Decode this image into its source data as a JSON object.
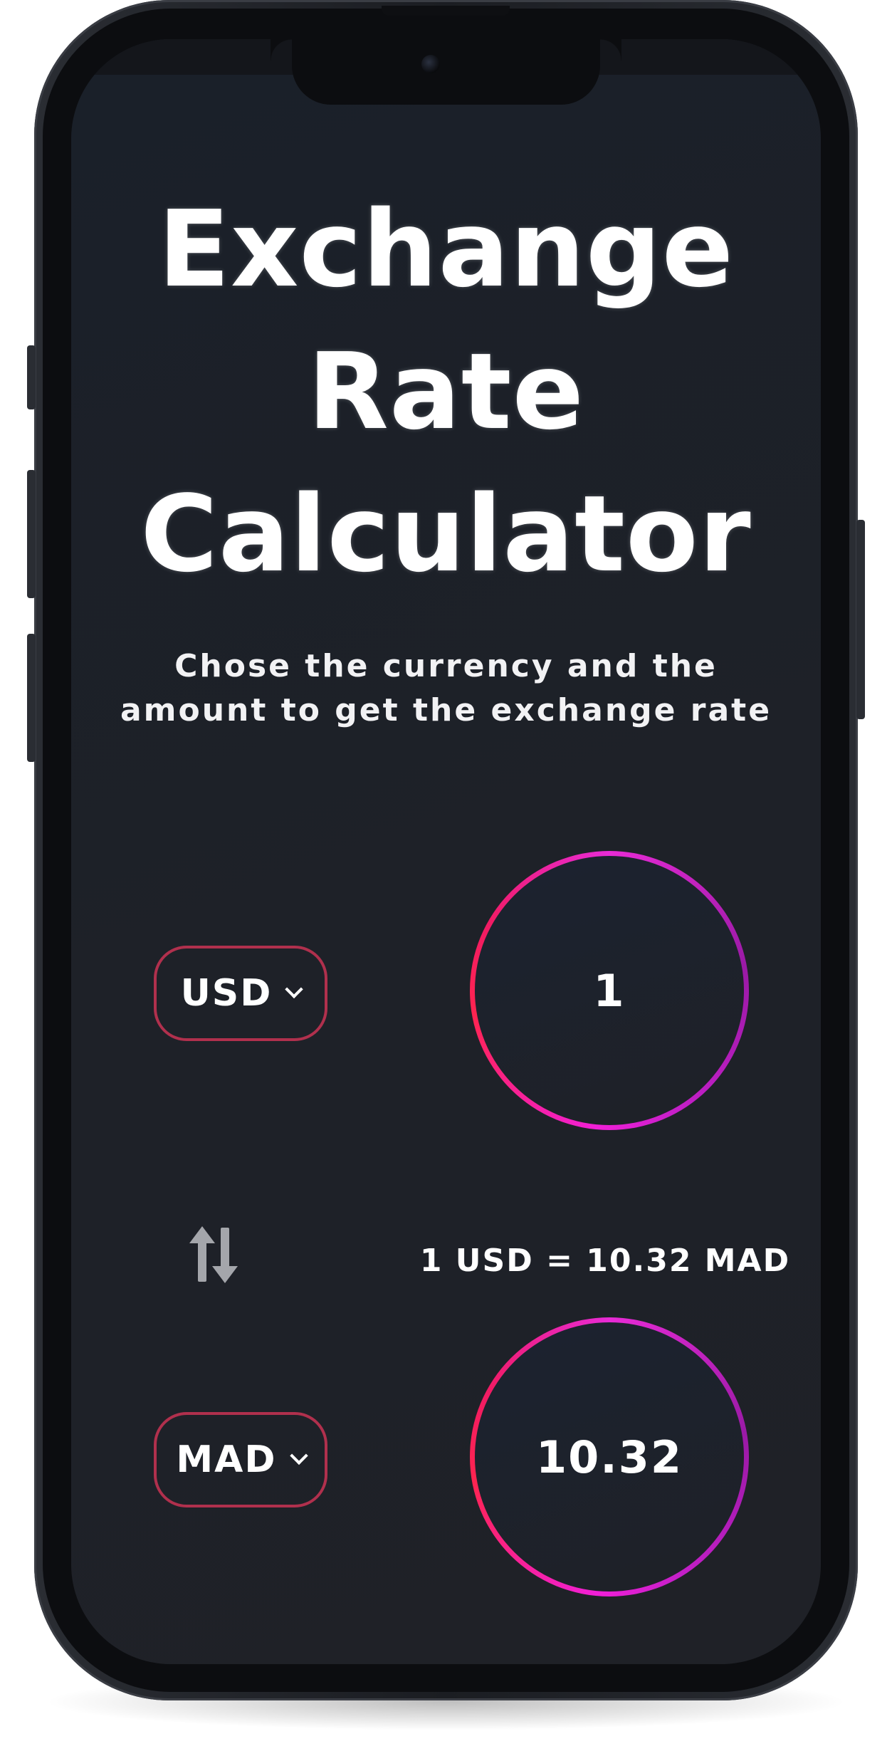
{
  "app": {
    "title_lines": [
      "Exchange",
      "Rate",
      "Calculator"
    ],
    "subtitle": "Chose the currency and the amount to get the exchange rate"
  },
  "from": {
    "currency": "USD",
    "amount": "1"
  },
  "to": {
    "currency": "MAD",
    "amount": "10.32"
  },
  "rate_text": "1 USD = 10.32 MAD",
  "icons": {
    "swap": "swap-arrows-icon",
    "chevron": "chevron-down-icon"
  },
  "colors": {
    "background": "#1f2127",
    "select_border": "#b0304d",
    "ring_pink": "#e82bd6",
    "ring_red": "#ff2450",
    "ring_purple": "#9a1aa6",
    "text": "#ffffff",
    "swap_icon": "#a4a6ab"
  }
}
